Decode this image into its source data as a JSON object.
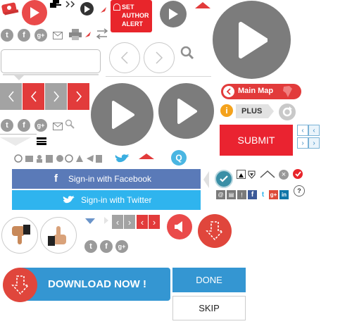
{
  "colors": {
    "red": "#e23b3b",
    "gray": "#7f7f7f",
    "lightgray": "#a3a3a3",
    "blue_fb": "#5a7ab8",
    "blue_tw": "#2fb4ee",
    "blue_btn": "#3496d2",
    "orange": "#f4a21c",
    "teal": "#3a8fa6",
    "brand_red": "#ea2330"
  },
  "author_alert": {
    "line1": "SET",
    "line2": "AUTHOR",
    "line3": "ALERT"
  },
  "nav": {
    "main_map": "Main Map"
  },
  "plus_label": "PLUS",
  "submit_label": "SUBMIT",
  "facebook_signin": "Sign-in with Facebook",
  "twitter_signin": "Sign-in with Twitter",
  "download_label": "DOWNLOAD NOW !",
  "done_label": "DONE",
  "skip_label": "SKIP",
  "social": {
    "twitter": "t",
    "facebook": "f",
    "google": "g+"
  },
  "misc": {
    "help_q": "?",
    "search_q": "Q",
    "info_i": "i",
    "ie_in": "in"
  },
  "icons": [
    "play-icon",
    "search-icon",
    "mail-icon",
    "print-icon",
    "share-icon",
    "chevron-left-icon",
    "chevron-right-icon",
    "refresh-icon",
    "check-icon",
    "close-icon",
    "thumbs-down-icon",
    "thumbs-up-icon",
    "volume-icon",
    "download-arrow-icon",
    "twitter-bird-icon",
    "facebook-f-icon"
  ]
}
